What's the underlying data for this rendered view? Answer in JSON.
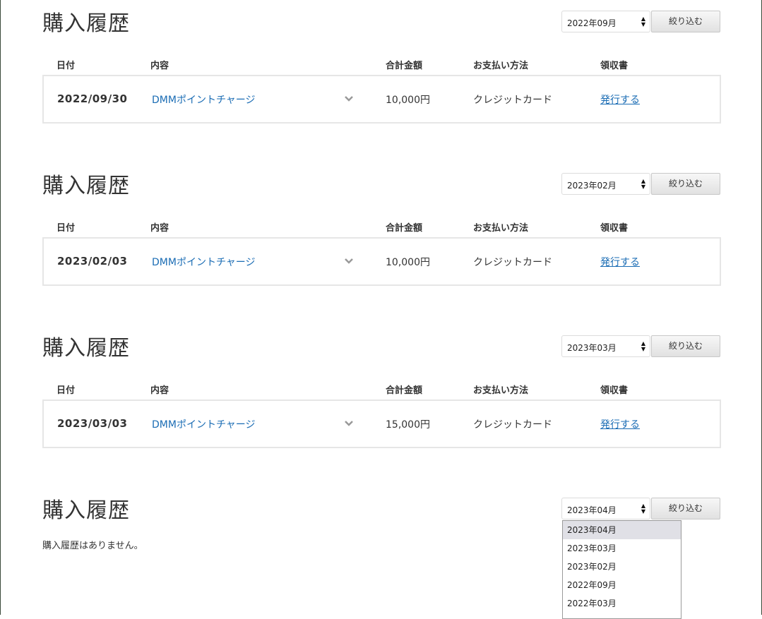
{
  "sections": [
    {
      "title": "購入履歴",
      "selected_month": "2022年09月",
      "filter_label": "絞り込む",
      "headers": {
        "date": "日付",
        "content": "内容",
        "amount": "合計金額",
        "payment": "お支払い方法",
        "receipt": "領収書"
      },
      "row": {
        "date": "2022/09/30",
        "content": "DMMポイントチャージ",
        "amount": "10,000円",
        "payment": "クレジットカード",
        "receipt": "発行する"
      }
    },
    {
      "title": "購入履歴",
      "selected_month": "2023年02月",
      "filter_label": "絞り込む",
      "headers": {
        "date": "日付",
        "content": "内容",
        "amount": "合計金額",
        "payment": "お支払い方法",
        "receipt": "領収書"
      },
      "row": {
        "date": "2023/02/03",
        "content": "DMMポイントチャージ",
        "amount": "10,000円",
        "payment": "クレジットカード",
        "receipt": "発行する"
      }
    },
    {
      "title": "購入履歴",
      "selected_month": "2023年03月",
      "filter_label": "絞り込む",
      "headers": {
        "date": "日付",
        "content": "内容",
        "amount": "合計金額",
        "payment": "お支払い方法",
        "receipt": "領収書"
      },
      "row": {
        "date": "2023/03/03",
        "content": "DMMポイントチャージ",
        "amount": "15,000円",
        "payment": "クレジットカード",
        "receipt": "発行する"
      }
    },
    {
      "title": "購入履歴",
      "selected_month": "2023年04月",
      "filter_label": "絞り込む",
      "empty_message": "購入履歴はありません。"
    }
  ],
  "dropdown": {
    "options": [
      "2023年04月",
      "2023年03月",
      "2023年02月",
      "2022年09月",
      "2022年03月"
    ],
    "selected_index": 0
  },
  "icons": {
    "select_arrows": "up-down-arrows-icon",
    "expand": "chevron-down-icon"
  },
  "colors": {
    "link": "#1a6cb4",
    "text": "#333333",
    "border": "#e6e6e6"
  }
}
